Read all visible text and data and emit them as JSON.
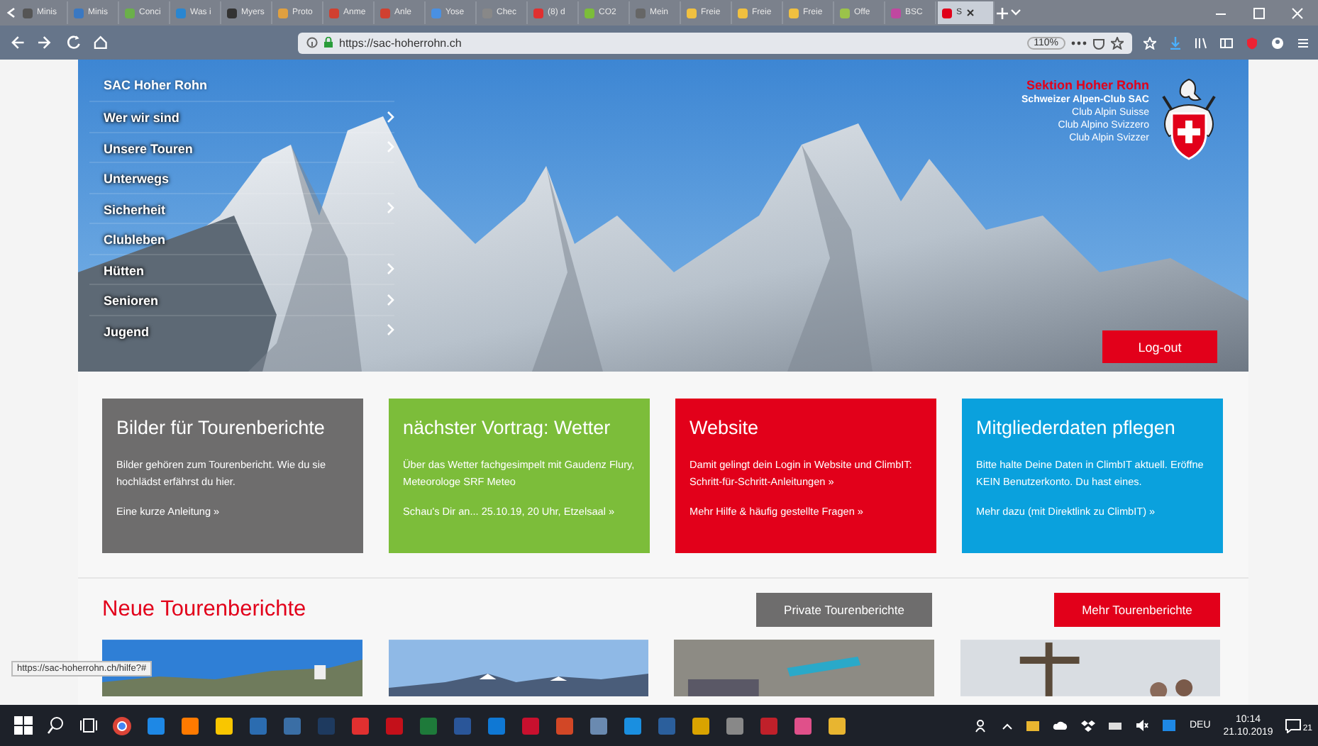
{
  "browser": {
    "tabs": [
      {
        "label": "Minis",
        "selected": false
      },
      {
        "label": "Minis",
        "selected": false
      },
      {
        "label": "Conci",
        "selected": false
      },
      {
        "label": "Was i",
        "selected": false
      },
      {
        "label": "Myers",
        "selected": false
      },
      {
        "label": "Proto",
        "selected": false
      },
      {
        "label": "Anme",
        "selected": false
      },
      {
        "label": "Anle",
        "selected": false
      },
      {
        "label": "Yose",
        "selected": false
      },
      {
        "label": "Chec",
        "selected": false
      },
      {
        "label": "(8) d",
        "selected": false
      },
      {
        "label": "CO2",
        "selected": false
      },
      {
        "label": "Mein",
        "selected": false
      },
      {
        "label": "Freie",
        "selected": false
      },
      {
        "label": "Freie",
        "selected": false
      },
      {
        "label": "Freie",
        "selected": false
      },
      {
        "label": "Offe",
        "selected": false
      },
      {
        "label": "BSC",
        "selected": false
      },
      {
        "label": "S",
        "selected": true
      }
    ],
    "url": "https://sac-hoherrohn.ch",
    "zoom": "110%"
  },
  "nav": {
    "title": "SAC Hoher Rohn",
    "items": [
      {
        "label": "Wer wir sind",
        "submenu": true
      },
      {
        "label": "Unsere Touren",
        "submenu": true
      },
      {
        "label": "Unterwegs",
        "submenu": false
      },
      {
        "label": "Sicherheit",
        "submenu": true
      },
      {
        "label": "Clubleben",
        "submenu": false
      },
      {
        "label": "Hütten",
        "submenu": true
      },
      {
        "label": "Senioren",
        "submenu": true
      },
      {
        "label": "Jugend",
        "submenu": true
      }
    ]
  },
  "logo": {
    "section": "Sektion Hoher Rohn",
    "lines": [
      "Schweizer Alpen-Club SAC",
      "Club Alpin Suisse",
      "Club Alpino Svizzero",
      "Club Alpin Svizzer"
    ]
  },
  "logout": "Log-out",
  "cards": [
    {
      "title": "Bilder für Tourenberichte",
      "text": "Bilder gehören zum Tourenbericht. Wie du sie hochlädst erfährst du hier.",
      "link": "Eine kurze Anleitung »",
      "color": "#6e6d6d"
    },
    {
      "title": "nächster Vortrag: Wetter",
      "text": "Über das Wetter fachgesimpelt mit Gaudenz Flury, Meteorologe SRF Meteo",
      "link": "Schau's Dir an... 25.10.19, 20 Uhr, Etzelsaal »",
      "color": "#7cbd3a"
    },
    {
      "title": "Website",
      "text": "Damit gelingt dein Login in Website und ClimbIT: Schritt-für-Schritt-Anleitungen »",
      "link": "Mehr Hilfe & häufig gestellte Fragen »",
      "color": "#e2001a"
    },
    {
      "title": "Mitgliederdaten pflegen",
      "text": "Bitte halte Deine Daten in ClimbIT aktuell. Eröffne KEIN Benutzerkonto. Du hast eines.",
      "link": "Mehr dazu (mit Direktlink zu ClimbIT) »",
      "color": "#0aa1dd"
    }
  ],
  "tours": {
    "heading": "Neue Tourenberichte",
    "buttons": [
      {
        "label": "Private Tourenberichte",
        "kind": "secondary"
      },
      {
        "label": "Mehr Tourenberichte",
        "kind": "primary"
      }
    ]
  },
  "status_url": "https://sac-hoherrohn.ch/hilfe?#",
  "taskbar": {
    "language": "DEU",
    "time": "10:14",
    "date": "21.10.2019",
    "notifications": "21"
  }
}
